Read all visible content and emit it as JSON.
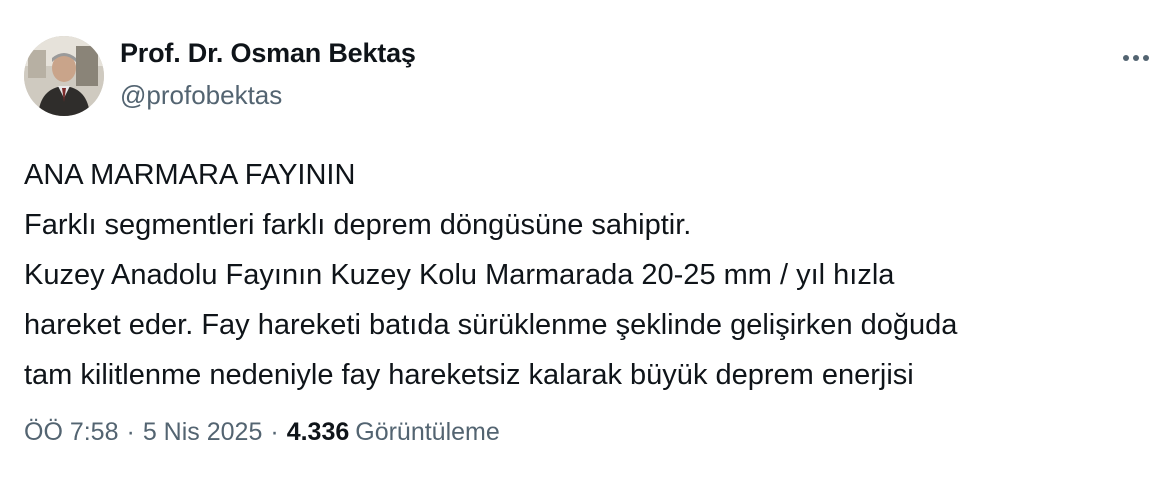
{
  "author": {
    "display_name": "Prof. Dr. Osman Bektaş",
    "handle": "@profobektas",
    "avatar_icon": "profile-photo"
  },
  "more_menu_icon": "more-horizontal-icon",
  "tweet": {
    "lines": [
      "ANA MARMARA FAYININ",
      "Farklı segmentleri farklı deprem döngüsüne sahiptir.",
      "Kuzey Anadolu Fayının Kuzey Kolu Marmarada 20-25 mm / yıl hızla",
      "hareket eder. Fay hareketi batıda sürüklenme şeklinde gelişirken doğuda",
      "tam kilitlenme nedeniyle fay hareketsiz kalarak büyük deprem enerjisi"
    ]
  },
  "meta": {
    "time": "ÖÖ 7:58",
    "separator": "·",
    "date": "5 Nis 2025",
    "view_count": "4.336",
    "views_label": "Görüntüleme"
  },
  "colors": {
    "text_primary": "#0f1419",
    "text_secondary": "#536471",
    "background": "#ffffff"
  }
}
